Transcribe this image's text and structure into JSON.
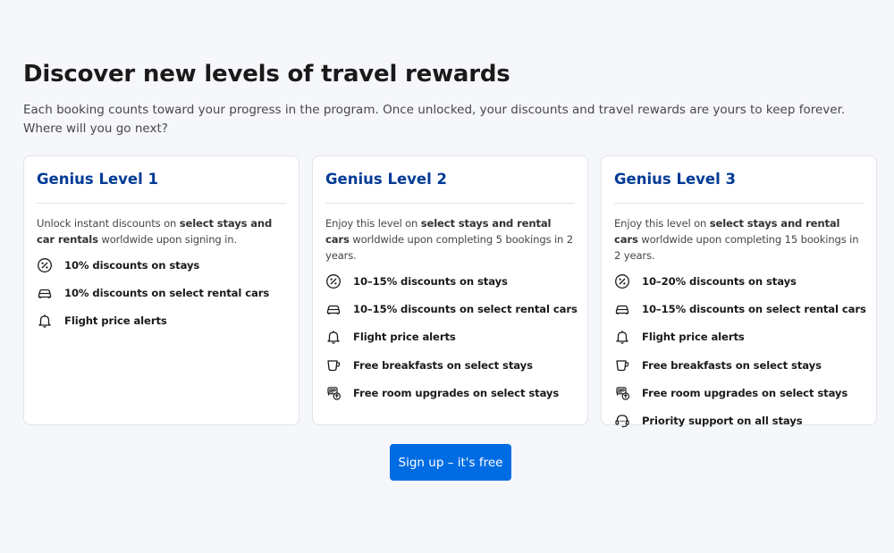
{
  "heading": "Discover new levels of travel rewards",
  "subheading": "Each booking counts toward your progress in the program. Once unlocked, your discounts and travel rewards are yours to keep forever. Where will you go next?",
  "cards": [
    {
      "title": "Genius Level 1",
      "desc_parts": [
        {
          "text": "Unlock instant discounts on ",
          "bold": false
        },
        {
          "text": "select stays and car rentals",
          "bold": true
        },
        {
          "text": " worldwide upon signing in.",
          "bold": false
        }
      ],
      "perks": [
        {
          "icon": "percent-icon",
          "label": "10% discounts on stays"
        },
        {
          "icon": "car-icon",
          "label": "10% discounts on select rental cars"
        },
        {
          "icon": "bell-icon",
          "label": "Flight price alerts"
        }
      ]
    },
    {
      "title": "Genius Level 2",
      "desc_parts": [
        {
          "text": "Enjoy this level on ",
          "bold": false
        },
        {
          "text": "select stays and rental cars",
          "bold": true
        },
        {
          "text": " worldwide upon completing 5 bookings in 2 years.",
          "bold": false
        }
      ],
      "perks": [
        {
          "icon": "percent-icon",
          "label": "10–15% discounts on stays"
        },
        {
          "icon": "car-icon",
          "label": "10–15% discounts on select rental cars"
        },
        {
          "icon": "bell-icon",
          "label": "Flight price alerts"
        },
        {
          "icon": "coffee-cup-icon",
          "label": "Free breakfasts on select stays"
        },
        {
          "icon": "bed-upgrade-icon",
          "label": "Free room upgrades on select stays"
        }
      ]
    },
    {
      "title": "Genius Level 3",
      "desc_parts": [
        {
          "text": "Enjoy this level on ",
          "bold": false
        },
        {
          "text": "select stays and rental cars",
          "bold": true
        },
        {
          "text": " worldwide upon completing 15 bookings in 2 years.",
          "bold": false
        }
      ],
      "perks": [
        {
          "icon": "percent-icon",
          "label": "10–20% discounts on stays"
        },
        {
          "icon": "car-icon",
          "label": "10–15% discounts on select rental cars"
        },
        {
          "icon": "bell-icon",
          "label": "Flight price alerts"
        },
        {
          "icon": "coffee-cup-icon",
          "label": "Free breakfasts on select stays"
        },
        {
          "icon": "bed-upgrade-icon",
          "label": "Free room upgrades on select stays"
        },
        {
          "icon": "headset-support-icon",
          "label": "Priority support on all stays"
        }
      ]
    }
  ],
  "cta": {
    "label": "Sign up – it's free"
  },
  "colors": {
    "background": "#f5f7fb",
    "title_blue": "#003b95",
    "button_blue": "#006ce4"
  }
}
